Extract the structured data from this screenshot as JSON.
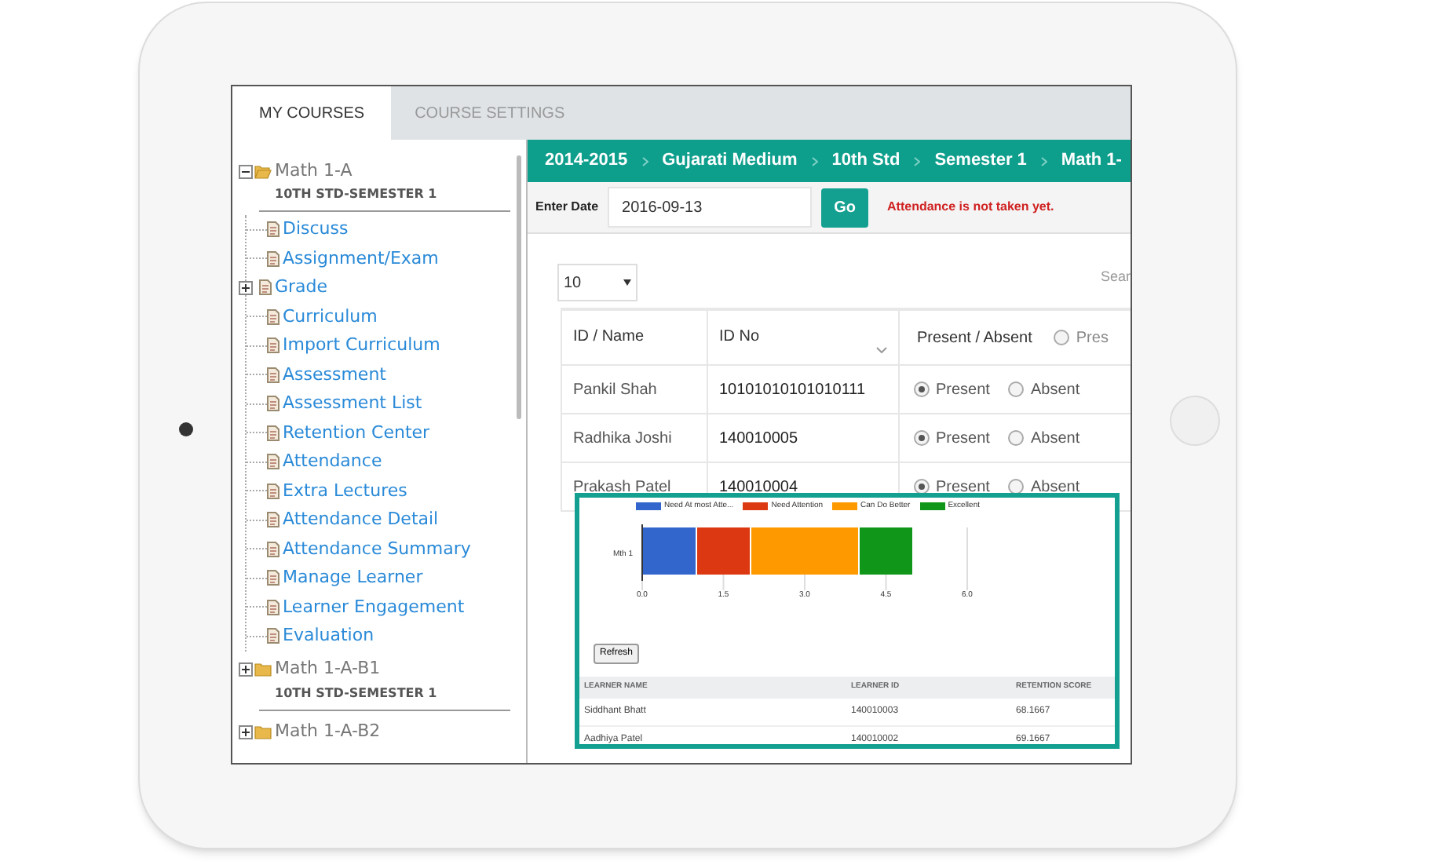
{
  "tabs": [
    {
      "label": "MY COURSES",
      "selected": true
    },
    {
      "label": "COURSE SETTINGS",
      "selected": false
    }
  ],
  "sidebar": {
    "tree": [
      {
        "label": "Math 1-A",
        "subtitle": "10TH STD-SEMESTER 1",
        "expanded": true,
        "children": [
          {
            "label": "Discuss",
            "expandable": false
          },
          {
            "label": "Assignment/Exam",
            "expandable": false
          },
          {
            "label": "Grade",
            "expandable": true
          },
          {
            "label": "Curriculum",
            "expandable": false
          },
          {
            "label": "Import Curriculum",
            "expandable": false
          },
          {
            "label": "Assessment",
            "expandable": false
          },
          {
            "label": "Assessment List",
            "expandable": false
          },
          {
            "label": "Retention Center",
            "expandable": false
          },
          {
            "label": "Attendance",
            "expandable": false
          },
          {
            "label": "Extra Lectures",
            "expandable": false
          },
          {
            "label": "Attendance Detail",
            "expandable": false
          },
          {
            "label": "Attendance Summary",
            "expandable": false
          },
          {
            "label": "Manage Learner",
            "expandable": false
          },
          {
            "label": "Learner Engagement",
            "expandable": false
          },
          {
            "label": "Evaluation",
            "expandable": false
          }
        ]
      },
      {
        "label": "Math 1-A-B1",
        "subtitle": "10TH STD-SEMESTER 1",
        "expanded": false
      },
      {
        "label": "Math 1-A-B2",
        "expanded": false
      }
    ]
  },
  "breadcrumb": [
    "2014-2015",
    "Gujarati Medium",
    "10th Std",
    "Semester 1",
    "Math 1-"
  ],
  "date_bar": {
    "label": "Enter Date",
    "value": "2016-09-13",
    "button": "Go",
    "message": "Attendance is not taken yet."
  },
  "page_size": "10",
  "search_label": "Sear",
  "table": {
    "columns": [
      "ID / Name",
      "ID No",
      "Present / Absent",
      "Pres"
    ],
    "header_radio_selected": false,
    "rows": [
      {
        "name": "Pankil Shah",
        "id": "10101010101010111",
        "present": true,
        "present_label": "Present",
        "absent_label": "Absent"
      },
      {
        "name": "Radhika Joshi",
        "id": "140010005",
        "present": true,
        "present_label": "Present",
        "absent_label": "Absent"
      },
      {
        "name": "Prakash Patel",
        "id": "140010004",
        "present": true,
        "present_label": "Present",
        "absent_label": "Absent"
      }
    ]
  },
  "popup": {
    "chart_data": {
      "type": "bar",
      "orientation": "horizontal",
      "stacked": true,
      "categories": [
        "Mth 1"
      ],
      "series": [
        {
          "name": "Need At most Atte...",
          "color": "#3366cc",
          "values": [
            1.0
          ]
        },
        {
          "name": "Need Attention",
          "color": "#dc3912",
          "values": [
            1.0
          ]
        },
        {
          "name": "Can Do Better",
          "color": "#ff9900",
          "values": [
            2.0
          ]
        },
        {
          "name": "Excellent",
          "color": "#109618",
          "values": [
            1.0
          ]
        }
      ],
      "xlim": [
        0,
        6
      ],
      "grid": true,
      "legend": true,
      "xticks": [
        {
          "value": 0,
          "label": "0.0"
        },
        {
          "value": 1.5,
          "label": "1.5"
        },
        {
          "value": 3,
          "label": "3.0"
        },
        {
          "value": 4.5,
          "label": "4.5"
        },
        {
          "value": 6,
          "label": "6.0"
        }
      ]
    },
    "refresh": "Refresh",
    "columns": [
      "LEARNER NAME",
      "LEARNER ID",
      "RETENTION SCORE"
    ],
    "rows": [
      [
        "Siddhant Bhatt",
        "140010003",
        "68.1667"
      ],
      [
        "Aadhiya Patel",
        "140010002",
        "69.1667"
      ]
    ]
  }
}
